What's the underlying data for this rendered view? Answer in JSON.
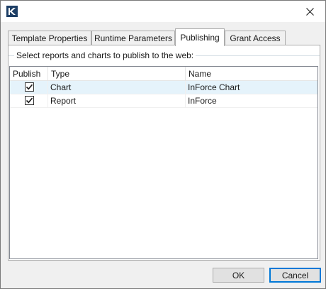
{
  "window": {
    "close_label": "×"
  },
  "tabs": [
    {
      "label": "Template Properties",
      "active": false
    },
    {
      "label": "Runtime Parameters",
      "active": false
    },
    {
      "label": "Publishing",
      "active": true
    },
    {
      "label": "Grant Access",
      "active": false
    }
  ],
  "publishing": {
    "group_label": "Select reports and charts to publish to the web:",
    "columns": [
      "Publish",
      "Type",
      "Name"
    ],
    "rows": [
      {
        "publish": true,
        "type": "Chart",
        "name": "InForce Chart",
        "selected": true
      },
      {
        "publish": true,
        "type": "Report",
        "name": "InForce",
        "selected": false
      }
    ]
  },
  "buttons": {
    "ok_label": "OK",
    "cancel_label": "Cancel"
  },
  "colors": {
    "selection": "#e5f3fb",
    "focus_border": "#0078d7"
  }
}
